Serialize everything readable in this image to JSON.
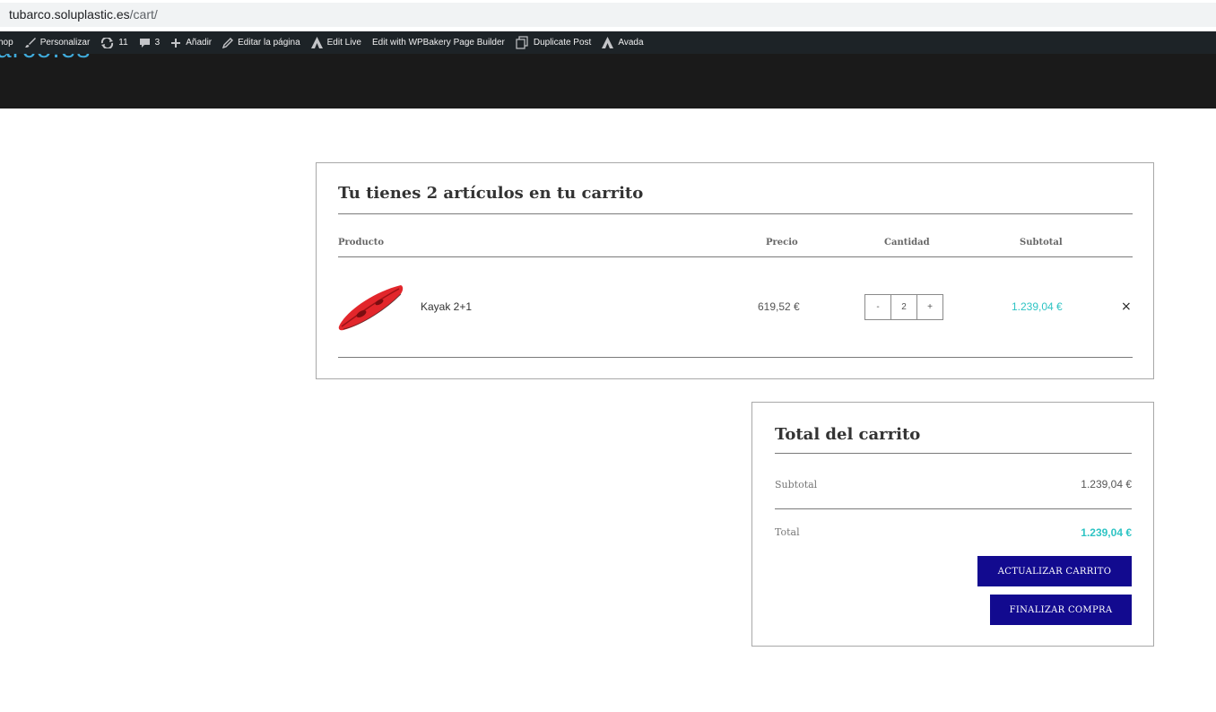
{
  "browser": {
    "url_domain": "tubarco.soluplastic.es",
    "url_path": "/cart/"
  },
  "adminbar": {
    "shop": "hop",
    "customize": "Personalizar",
    "updates_count": "11",
    "comments_count": "3",
    "add_new": "Añadir",
    "edit_page": "Editar la página",
    "edit_live": "Edit Live",
    "wpbakery": "Edit with WPBakery Page Builder",
    "duplicate": "Duplicate Post",
    "avada": "Avada"
  },
  "header": {
    "logo_fragment": "arco.es"
  },
  "cart": {
    "title": "Tu tienes 2 artículos en tu carrito",
    "columns": {
      "product": "Producto",
      "price": "Precio",
      "quantity": "Cantidad",
      "subtotal": "Subtotal"
    },
    "items": [
      {
        "name": "Kayak 2+1",
        "price": "619,52 €",
        "quantity": "2",
        "minus": "-",
        "plus": "+",
        "subtotal": "1.239,04 €",
        "remove": "×"
      }
    ]
  },
  "totals": {
    "title": "Total del carrito",
    "subtotal_label": "Subtotal",
    "subtotal_value": "1.239,04 €",
    "total_label": "Total",
    "total_value": "1.239,04 €",
    "update_button": "ACTUALIZAR CARRITO",
    "checkout_button": "FINALIZAR COMPRA"
  },
  "colors": {
    "accent_teal": "#2ec4c4",
    "button_navy": "#120a8f",
    "adminbar_bg": "#1d2327",
    "header_bg": "#1a1a1a"
  }
}
